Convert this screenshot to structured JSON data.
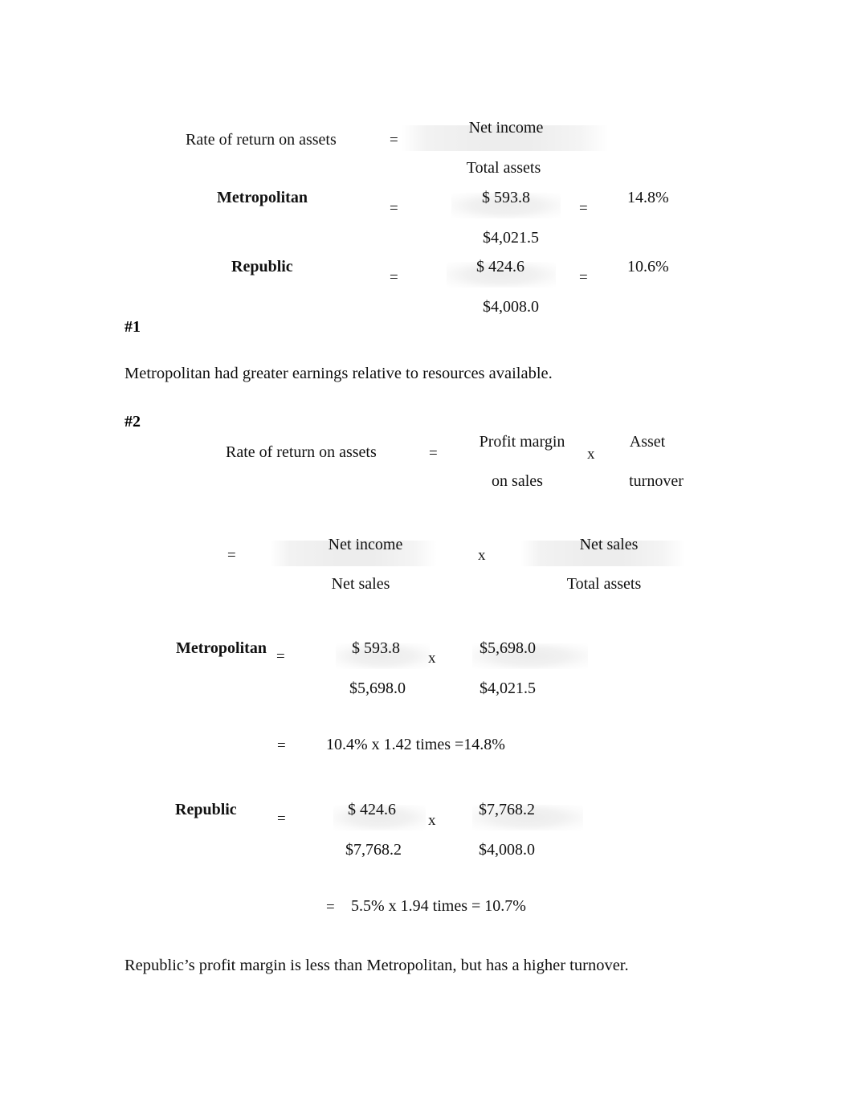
{
  "document": {
    "page_background": "#ffffff",
    "text_color": "#111111"
  },
  "section1": {
    "formula": {
      "label": "Rate of return on assets",
      "equals": "=",
      "numerator": "Net income",
      "denominator": "Total assets"
    },
    "rows": [
      {
        "company": "Metropolitan",
        "equals": "=",
        "numerator": "$ 593.8",
        "denominator": "$4,021.5",
        "equals2": "=",
        "result": "14.8%"
      },
      {
        "company": "Republic",
        "equals": "=",
        "numerator": "$  424.6",
        "denominator": "$4,008.0",
        "equals2": "=",
        "result": "10.6%"
      }
    ]
  },
  "answer1": {
    "marker": "#1",
    "text": "Metropolitan had greater earnings relative to resources available."
  },
  "answer2": {
    "marker": "#2"
  },
  "section2": {
    "formula_words": {
      "label": "Rate of return on assets",
      "equals": "=",
      "term1_line1": "Profit margin",
      "term1_line2": "on sales",
      "times": "x",
      "term2_line1": "Asset",
      "term2_line2": "turnover"
    },
    "formula_terms": {
      "equals": "=",
      "frac1_numerator": "Net income",
      "frac1_denominator": "Net sales",
      "times": "x",
      "frac2_numerator": "Net sales",
      "frac2_denominator": "Total assets"
    },
    "metropolitan": {
      "company": "Metropolitan",
      "equals": "=",
      "frac1_numerator": "$  593.8",
      "frac1_denominator": "$5,698.0",
      "times": "x",
      "frac2_numerator": "$5,698.0",
      "frac2_denominator": "$4,021.5",
      "result_equals": "=",
      "result": "10.4%  x  1.42 times =14.8%"
    },
    "republic": {
      "company": "Republic",
      "equals": "=",
      "frac1_numerator": "$  424.6",
      "frac1_denominator": "$7,768.2",
      "times": "x",
      "frac2_numerator": "$7,768.2",
      "frac2_denominator": "$4,008.0",
      "result_equals": "=",
      "result": "5.5%    x  1.94 times  =  10.7%"
    }
  },
  "conclusion": {
    "text": "Republic’s profit margin is less than Metropolitan, but has a higher turnover."
  }
}
